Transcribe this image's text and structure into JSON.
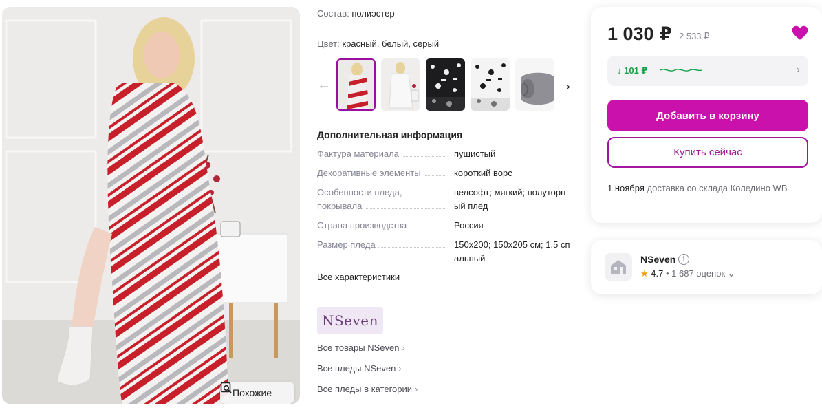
{
  "product": {
    "composition_label": "Состав:",
    "composition_value": "полиэстер",
    "color_label": "Цвет:",
    "color_value": "красный, белый, серый",
    "similar_button": "Похожие"
  },
  "gallery": {
    "arrow_left": "←",
    "arrow_right": "→",
    "thumbnails": [
      "red-deer-blanket",
      "white-blanket-woman",
      "black-white-pattern",
      "white-black-pattern",
      "grey-rolled-blanket"
    ]
  },
  "additional_info": {
    "title": "Дополнительная информация",
    "specs": [
      {
        "key": "Фактура материала",
        "value": "пушистый"
      },
      {
        "key": "Декоративные элементы",
        "value": "короткий ворс"
      },
      {
        "key1": "Особенности пледа,",
        "key2": "покрывала",
        "value1": "велсофт; мягкий; полуторн",
        "value2": "ый плед"
      },
      {
        "key": "Страна производства",
        "value": "Россия"
      },
      {
        "key": "Размер пледа",
        "value1": "150x200; 150x205 см; 1.5 сп",
        "value2": "альный"
      }
    ],
    "all_specs_link": "Все характеристики"
  },
  "brand": {
    "logo_text": "NSeven",
    "links": [
      "Все товары NSeven",
      "Все пледы NSeven",
      "Все пледы в категории"
    ],
    "chevron": "›"
  },
  "buy": {
    "price": "1 030 ₽",
    "old_price": "2 533 ₽",
    "bonus": "↓ 101 ₽",
    "bonus_chevron": "›",
    "add_to_cart": "Добавить в корзину",
    "buy_now": "Купить сейчас",
    "delivery_date": "1 ноября",
    "delivery_text": "доставка со склада Коледино WB"
  },
  "seller": {
    "name": "NSeven",
    "info": "i",
    "star": "★",
    "rating": "4.7",
    "reviews": "• 1 687 оценок",
    "chevron": "⌄"
  },
  "colors": {
    "accent": "#cb11ab",
    "accent_border": "#a0169c",
    "bonus_green": "#16a34a",
    "heart": "#cb11ab",
    "star": "#f59e0b"
  }
}
